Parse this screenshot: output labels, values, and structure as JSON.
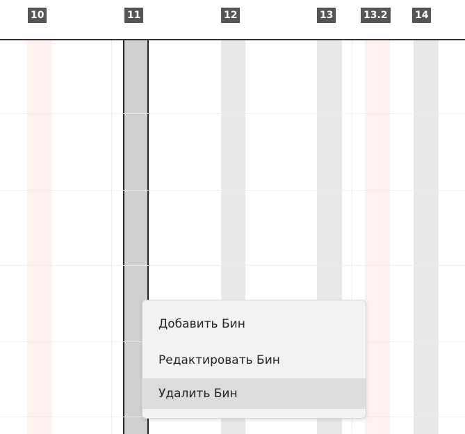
{
  "bins": [
    {
      "label": "10",
      "style": "pink"
    },
    {
      "label": "11",
      "style": "selected"
    },
    {
      "label": "12",
      "style": "grey"
    },
    {
      "label": "13",
      "style": "grey"
    },
    {
      "label": "13.2",
      "style": "pink"
    },
    {
      "label": "14",
      "style": "grey"
    }
  ],
  "context_menu": {
    "items": [
      {
        "label": "Добавить Бин",
        "state": "normal"
      },
      {
        "label": "Редактировать Бин",
        "state": "normal"
      },
      {
        "label": "Удалить Бин",
        "state": "hover"
      }
    ]
  },
  "colors": {
    "pink_band": "#fff0f0",
    "grey_band": "#e8e8e8",
    "selected_band": "#d0d0d0",
    "label_bg": "#555555",
    "menu_bg": "#f2f2f2",
    "menu_hover": "#dcdcdc"
  }
}
